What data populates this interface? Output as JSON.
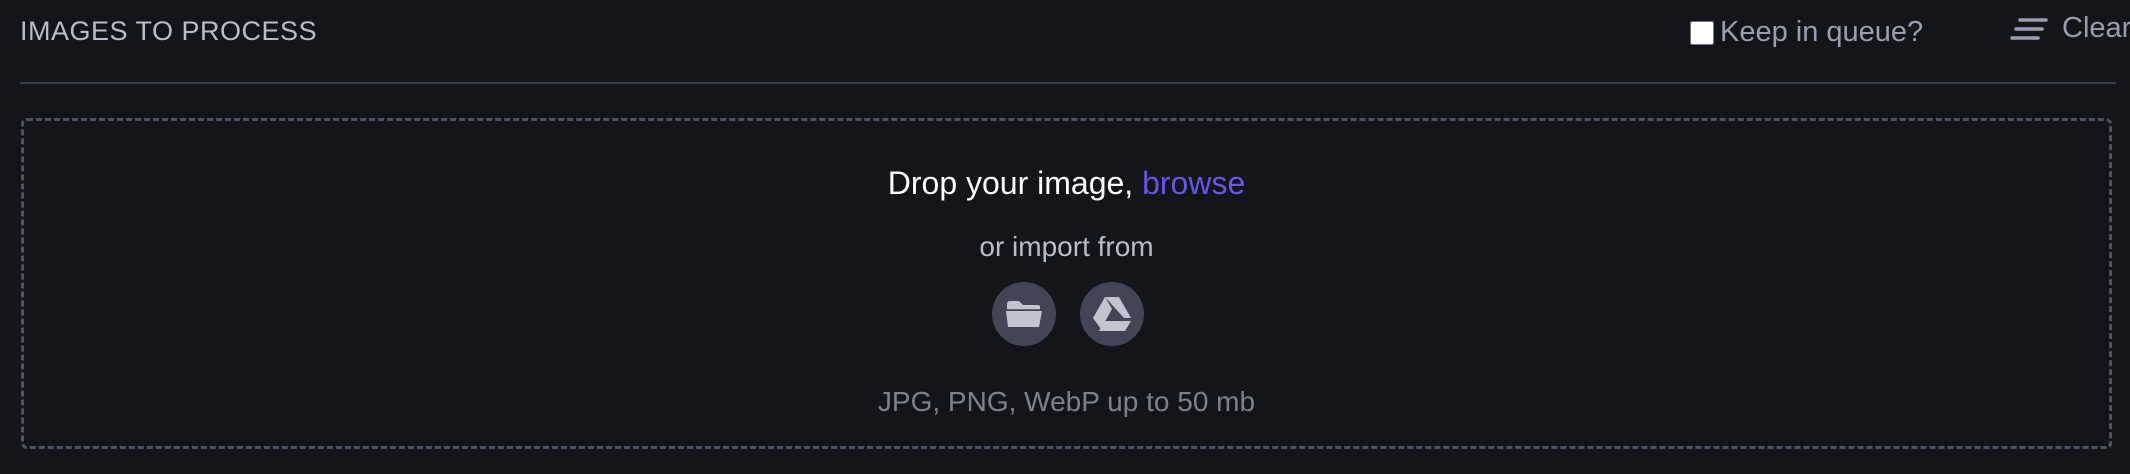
{
  "header": {
    "title": "IMAGES TO PROCESS",
    "keep_in_queue_label": "Keep in queue?",
    "keep_in_queue_checked": false,
    "clear_label": "Clear"
  },
  "dropzone": {
    "drop_text": "Drop your image, ",
    "browse_label": "browse",
    "import_label": "or import from",
    "import_sources": [
      {
        "icon": "folder-icon"
      },
      {
        "icon": "google-drive-icon"
      }
    ],
    "formats_text": "JPG, PNG, WebP up to 50 mb"
  },
  "colors": {
    "background": "#14151a",
    "accent": "#6358e6",
    "icon_circle": "#434456",
    "divider": "#3d3e52"
  }
}
